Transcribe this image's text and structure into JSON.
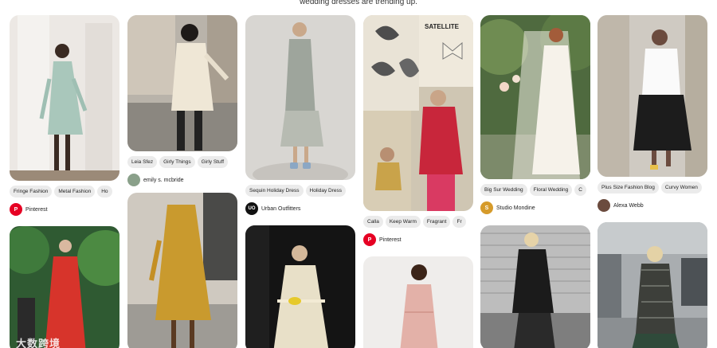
{
  "caption": "wedding dresses are trending up.",
  "pins": {
    "c1p1": {
      "tags": [
        "Fringe Fashion",
        "Metal Fashion",
        "Ho"
      ],
      "source": "Pinterest",
      "avatar_letter": "P"
    },
    "c2p1": {
      "tags": [
        "Leia Sfez",
        "Girly Things",
        "Girly Stuff"
      ],
      "source": "emily s. mcbride",
      "avatar_letter": ""
    },
    "c3p1": {
      "tags": [
        "Sequin Holiday Dress",
        "Holiday Dress"
      ],
      "source": "Urban Outfitters",
      "avatar_letter": "UO"
    },
    "c4p1": {
      "tags": [
        "Calla",
        "Keep Warm",
        "Fragrant",
        "Fr"
      ],
      "source": "Pinterest",
      "avatar_letter": "P"
    },
    "c5p1": {
      "tags": [
        "Big Sur Wedding",
        "Floral Wedding",
        "C"
      ],
      "source": "Studio Mondine",
      "avatar_letter": "S"
    },
    "c6p1": {
      "tags": [
        "Plus Size Fashion Blog",
        "Curvy Women"
      ],
      "source": "Alexa Webb",
      "avatar_letter": ""
    }
  },
  "collage_text": "SATELLITE",
  "watermark": "大数跨境",
  "colors": {
    "tag_bg": "#ebebeb",
    "pinterest_red": "#e60023"
  }
}
